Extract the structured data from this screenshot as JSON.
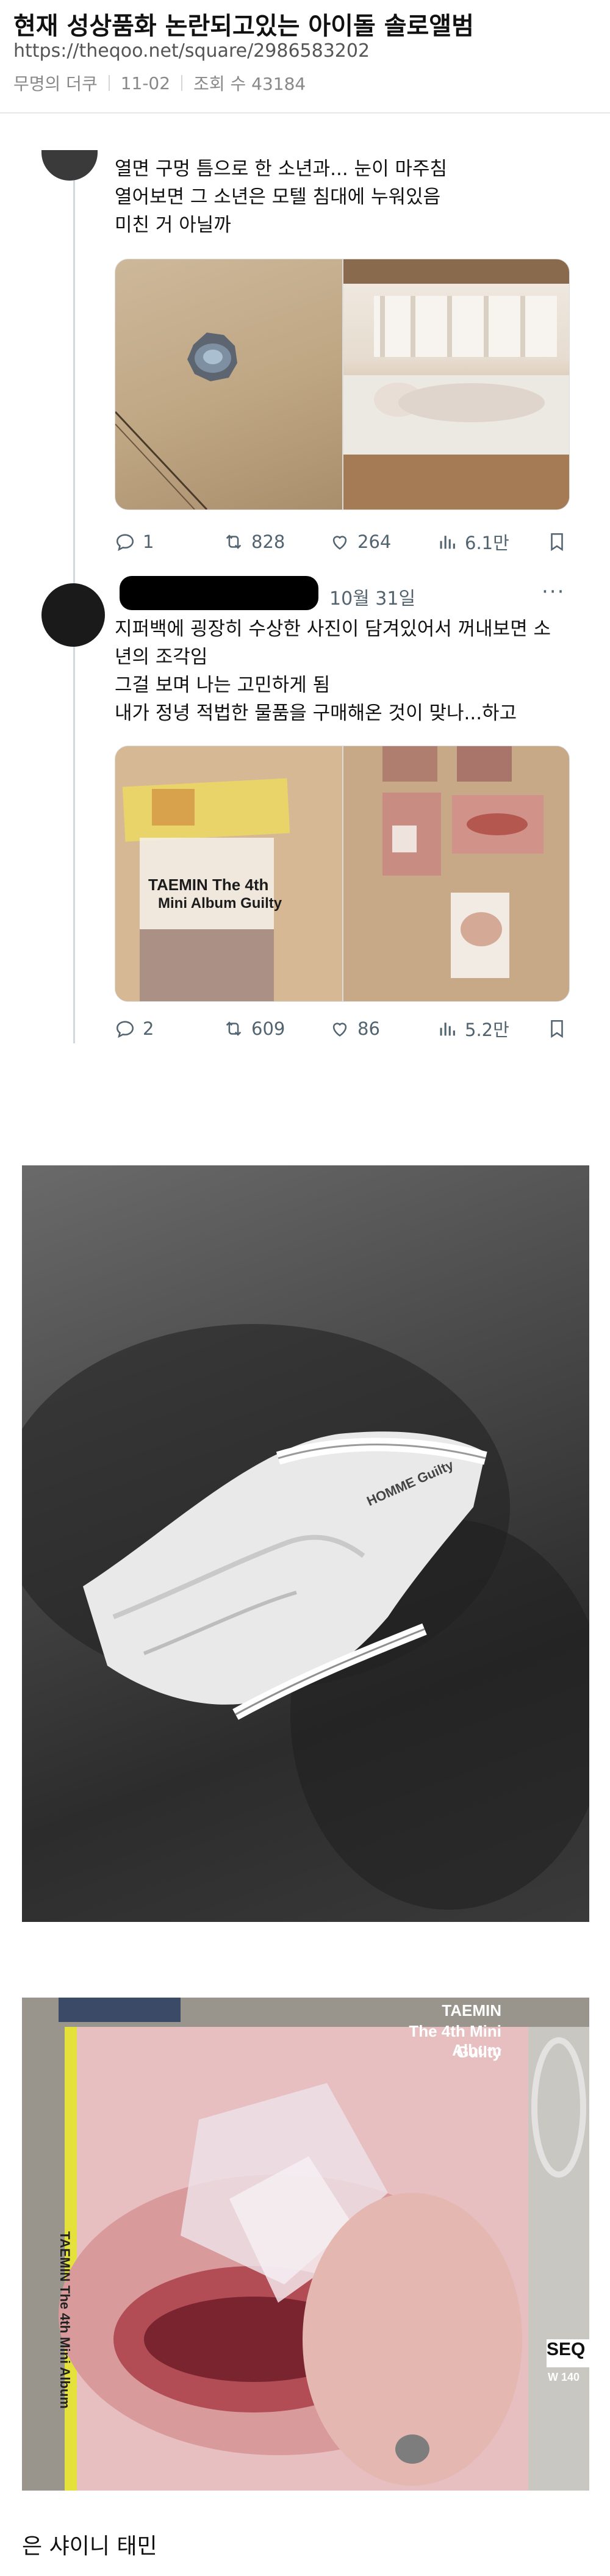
{
  "post": {
    "title": "현재 성상품화 논란되고있는 아이돌 솔로앨범",
    "url": "https://theqoo.net/square/2986583202",
    "author": "무명의 더쿠",
    "date": "11-02",
    "views": "조회 수 43184"
  },
  "tweet1": {
    "text": "열면 구멍 틈으로 한 소년과... 눈이 마주침\n열어보면 그 소년은 모텔 침대에 누워있음\n미친 거 아닐까",
    "replies": "1",
    "retweets": "828",
    "likes": "264",
    "views": "6.1만"
  },
  "tweet2": {
    "date": "10월 31일",
    "more": "···",
    "text": "지퍼백에 굉장히 수상한 사진이 담겨있어서 꺼내보면 소\n년의 조각임\n그걸 보며 나는 고민하게 됨\n내가 정녕 적법한 물품을 구매해온 것이 맞나...하고",
    "replies": "2",
    "retweets": "609",
    "likes": "86",
    "views": "5.2만",
    "album_card": {
      "line1": "TAEMIN The 4th",
      "line2": "Mini Album Guilty"
    }
  },
  "photo2": {
    "waistband_text": "HOMME Guilty"
  },
  "photo3": {
    "cover_line1": "TAEMIN",
    "cover_line2": "The 4th Mini Album",
    "cover_line3": "Guilty",
    "spine": "TAEMIN  The 4th Mini Album",
    "side_label": "SEQ",
    "side_sub": "W 140"
  },
  "caption": "은 샤이니 태민",
  "colors": {
    "text_secondary": "#536471",
    "divider": "#e6e6e6"
  }
}
